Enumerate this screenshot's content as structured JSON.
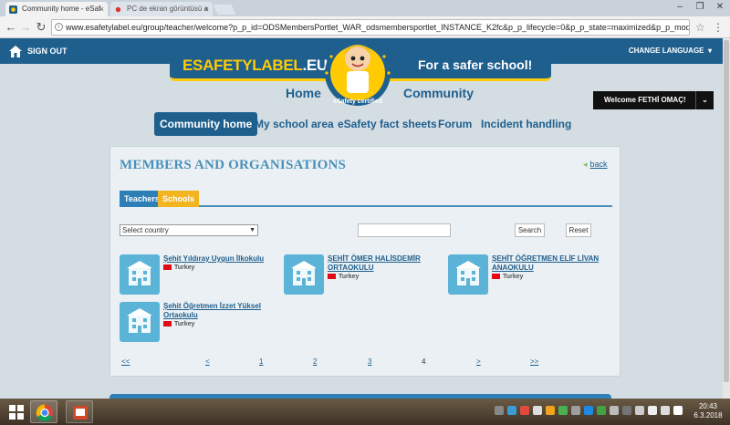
{
  "browser": {
    "tabs": [
      {
        "title": "Community home - eSaf",
        "active": true
      },
      {
        "title": "PC de ekran görüntüsü a",
        "active": false
      }
    ],
    "url": "www.esafetylabel.eu/group/teacher/welcome?p_p_id=ODSMembersPortlet_WAR_odsmembersportlet_INSTANCE_K2fc&p_p_lifecycle=0&p_p_state=maximized&p_p_mode=view&_ODSMem...",
    "window_controls": [
      "–",
      "❐",
      "✕"
    ]
  },
  "site": {
    "sign_out": "SIGN OUT",
    "change_language": "CHANGE LANGUAGE",
    "logo_text": "ESAFETYLABEL",
    "logo_tld": ".EU",
    "tagline": "For a safer school!",
    "badge_text": "eSafety certified",
    "main_nav": {
      "home": "Home",
      "community": "Community"
    },
    "welcome": "Welcome FETHİ OMAÇ!",
    "sub_nav": [
      "Community home",
      "My school area",
      "eSafety fact sheets",
      "Forum",
      "Incident handling"
    ]
  },
  "panel": {
    "title": "MEMBERS AND ORGANISATIONS",
    "back": "back",
    "tabs": [
      "Teachers",
      "Schools"
    ],
    "country_select": "Select country",
    "search_button": "Search",
    "reset_button": "Reset",
    "schools": [
      {
        "name": "Şehit Yıldıray Uygun İlkokulu",
        "country": "Turkey"
      },
      {
        "name": "ŞEHİT ÖMER HALİSDEMİR ORTAOKULU",
        "country": "Turkey"
      },
      {
        "name": "ŞEHİT ÖĞRETMEN ELİF LİVAN ANAOKULU",
        "country": "Turkey"
      },
      {
        "name": "Şehit Öğretmen İzzet Yüksel Ortaokulu",
        "country": "Turkey"
      }
    ],
    "pager": [
      "<<",
      "<",
      "1",
      "2",
      "3",
      "4",
      ">",
      ">>"
    ],
    "current_page": "4"
  },
  "taskbar": {
    "time": "20:43",
    "date": "6.3.2018"
  }
}
